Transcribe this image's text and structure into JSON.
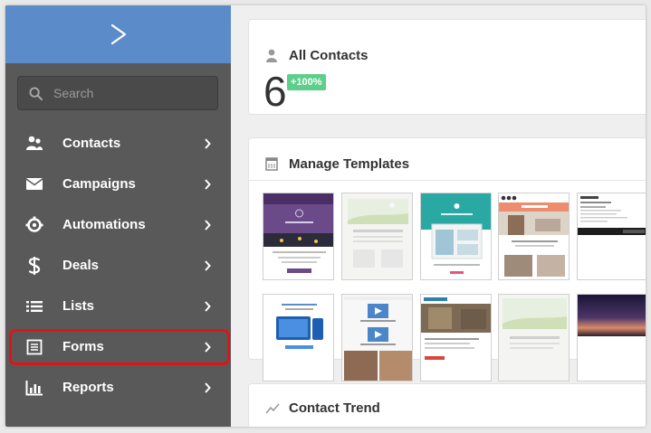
{
  "sidebar": {
    "logo": "chevron-logo",
    "search_placeholder": "Search",
    "items": [
      {
        "label": "Contacts",
        "icon": "contacts-icon"
      },
      {
        "label": "Campaigns",
        "icon": "envelope-icon"
      },
      {
        "label": "Automations",
        "icon": "automation-gear-icon"
      },
      {
        "label": "Deals",
        "icon": "dollar-icon"
      },
      {
        "label": "Lists",
        "icon": "list-icon"
      },
      {
        "label": "Forms",
        "icon": "form-icon"
      },
      {
        "label": "Reports",
        "icon": "bar-chart-icon"
      }
    ]
  },
  "all_contacts": {
    "title": "All Contacts",
    "count": "6",
    "change": "+100%"
  },
  "templates": {
    "title": "Manage Templates"
  },
  "trend": {
    "title": "Contact Trend"
  },
  "colors": {
    "brand": "#5b8bc9",
    "sidebar": "#595959",
    "badge": "#5ccf8a",
    "highlight": "#e01414"
  }
}
